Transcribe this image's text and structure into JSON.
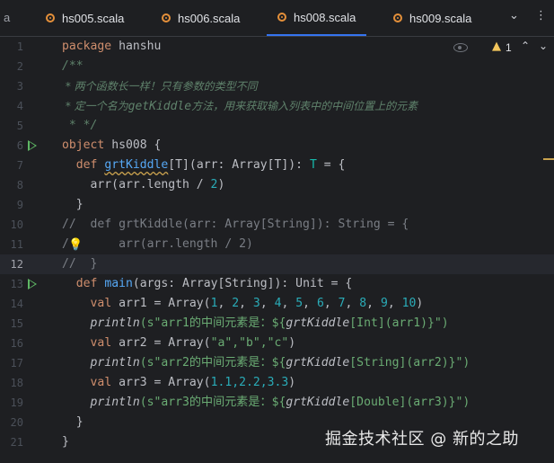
{
  "tabs": {
    "left_partial": "a",
    "items": [
      {
        "label": "hs005.scala"
      },
      {
        "label": "hs006.scala"
      },
      {
        "label": "hs008.scala"
      },
      {
        "label": "hs009.scala"
      }
    ],
    "active_index": 2,
    "menu_icon": "chevron-down",
    "more_icon": "vertical-dots"
  },
  "inspection": {
    "warning_count": "1",
    "icons": [
      "eye-icon",
      "warning-icon",
      "arrow-up-icon",
      "arrow-down-icon"
    ]
  },
  "editor": {
    "current_line": 12,
    "lines": [
      {
        "num": "1"
      },
      {
        "num": "2"
      },
      {
        "num": "3"
      },
      {
        "num": "4"
      },
      {
        "num": "5"
      },
      {
        "num": "6"
      },
      {
        "num": "7"
      },
      {
        "num": "8"
      },
      {
        "num": "9"
      },
      {
        "num": "10"
      },
      {
        "num": "11"
      },
      {
        "num": "12"
      },
      {
        "num": "13"
      },
      {
        "num": "14"
      },
      {
        "num": "15"
      },
      {
        "num": "16"
      },
      {
        "num": "17"
      },
      {
        "num": "18"
      },
      {
        "num": "19"
      },
      {
        "num": "20"
      },
      {
        "num": "21"
      }
    ],
    "code": {
      "l1_kw": "package",
      "l1_rest": " hanshu",
      "l2": "/**",
      "l3": " * 两个函数长一样！只有参数的类型不同",
      "l4a": " * 定一个名为",
      "l4b": "getKiddle",
      "l4c": "方法，用来获取输入列表中的中间位置上的元素",
      "l5": " * */",
      "l6_kw": "object",
      "l6_rest": " hs008 {",
      "l7_indent": "  ",
      "l7_kw": "def",
      "l7_sp": " ",
      "l7_fn": "grtKiddle",
      "l7_a": "[T](arr: Array[T]): ",
      "l7_t": "T",
      "l7_b": " = {",
      "l8_a": "    arr(arr.length / ",
      "l8_num": "2",
      "l8_b": ")",
      "l9": "  }",
      "l10": "//  def grtKiddle(arr: Array[String]): String = {",
      "l11a": "/",
      "l11b": "       arr(arr.length / 2)",
      "l12": "//  }",
      "l13_indent": "  ",
      "l13_kw": "def",
      "l13_sp": " ",
      "l13_fn": "main",
      "l13_rest": "(args: Array[String]): Unit = {",
      "l14_indent": "    ",
      "l14_kw": "val",
      "l14_a": " arr1 = Array(",
      "l14_nums": [
        "1",
        "2",
        "3",
        "4",
        "5",
        "6",
        "7",
        "8",
        "9",
        "10"
      ],
      "l15_fn": "println",
      "l15_s1": "(s\"arr1的中间元素是：${",
      "l15_call": "grtKiddle",
      "l15_s2": "[Int](arr1)}\")",
      "l16_kw": "val",
      "l16_a": " arr2 = Array(",
      "l16_s": "\"a\",\"b\",\"c\"",
      "l16_b": ")",
      "l17_fn": "println",
      "l17_s1": "(s\"arr2的中间元素是：${",
      "l17_call": "grtKiddle",
      "l17_s2": "[String](arr2)}\")",
      "l18_kw": "val",
      "l18_a": " arr3 = Array(",
      "l18_n": "1.1,2.2,3.3",
      "l18_b": ")",
      "l19_fn": "println",
      "l19_s1": "(s\"arr3的中间元素是：${",
      "l19_call": "grtKiddle",
      "l19_s2": "[Double](arr3)}\")",
      "l20": "  }",
      "l21": "}"
    }
  },
  "watermark": "掘金技术社区 @ 新的之助",
  "colors": {
    "background": "#1e1f22",
    "keyword": "#cf8e6d",
    "function": "#56a8f5",
    "number": "#2aacb8",
    "string": "#6aab73",
    "comment": "#7a7e85",
    "doc_comment": "#5f826b",
    "active_tab_underline": "#3574f0",
    "run_gutter": "#5fb865"
  }
}
